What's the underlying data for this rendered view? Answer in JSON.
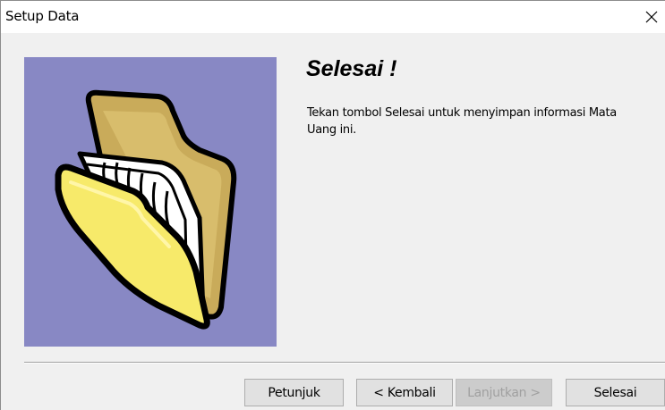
{
  "window": {
    "title": "Setup Data",
    "close_icon": "close-icon"
  },
  "art": {
    "icon": "folder-icon",
    "background_color": "#8888c4"
  },
  "content": {
    "heading": "Selesai !",
    "description": "Tekan tombol Selesai untuk menyimpan informasi Mata Uang ini."
  },
  "buttons": {
    "help": "Petunjuk",
    "back": "< Kembali",
    "next": "Lanjutkan >",
    "next_disabled": true,
    "finish": "Selesai"
  }
}
